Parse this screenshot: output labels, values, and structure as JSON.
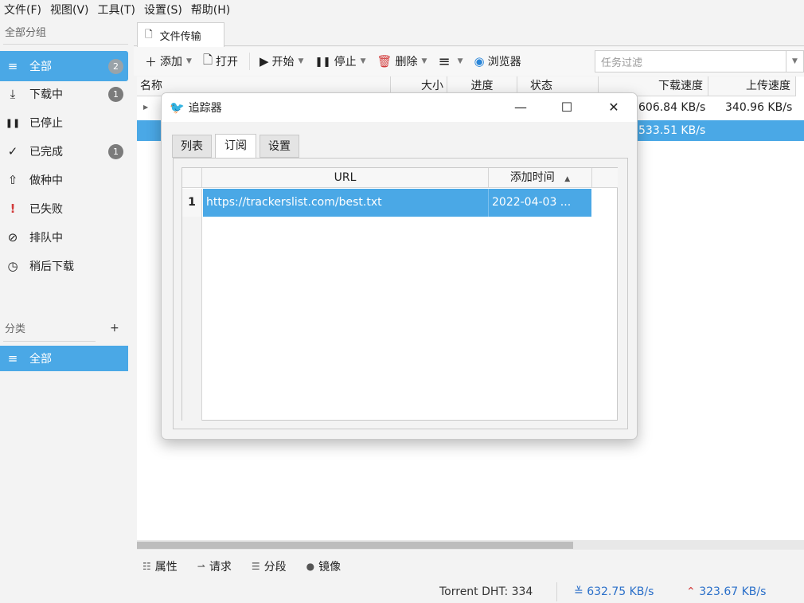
{
  "menu": [
    "文件(F)",
    "视图(V)",
    "工具(T)",
    "设置(S)",
    "帮助(H)"
  ],
  "sidebar": {
    "group_title": "全部分组",
    "items": [
      {
        "label": "全部",
        "icon": "≡",
        "badge": "2"
      },
      {
        "label": "下载中",
        "icon": "⤓",
        "badge": "1"
      },
      {
        "label": "已停止",
        "icon": "❚❚",
        "badge": ""
      },
      {
        "label": "已完成",
        "icon": "✓",
        "badge": "1"
      },
      {
        "label": "做种中",
        "icon": "⇧",
        "badge": ""
      },
      {
        "label": "已失败",
        "icon": "!",
        "badge": ""
      },
      {
        "label": "排队中",
        "icon": "⊘",
        "badge": ""
      },
      {
        "label": "稍后下载",
        "icon": "◷",
        "badge": ""
      }
    ],
    "category_title": "分类",
    "category_add": "+",
    "category_items": [
      {
        "label": "全部",
        "icon": "≡"
      }
    ]
  },
  "main_tab": {
    "label": "文件传输",
    "icon": "🗋"
  },
  "toolbar": {
    "add": "添加",
    "open": "打开",
    "start": "开始",
    "stop": "停止",
    "delete": "删除",
    "menu_icon": "≡",
    "browser": "浏览器",
    "filter_placeholder": "任务过滤"
  },
  "table": {
    "headers": [
      "名称",
      "大小",
      "进度",
      "状态",
      "下载速度",
      "上传速度"
    ],
    "rows": [
      {
        "name": "",
        "size": "",
        "progress": "",
        "status": "",
        "down": "606.84 KB/s",
        "up": "340.96 KB/s"
      },
      {
        "name": "",
        "size": "",
        "progress": "",
        "status": "",
        "down": "533.51 KB/s",
        "up": ""
      }
    ]
  },
  "bottom_tabs": [
    {
      "label": "属性",
      "icon": "☷"
    },
    {
      "label": "请求",
      "icon": "⇀"
    },
    {
      "label": "分段",
      "icon": "☰"
    },
    {
      "label": "镜像",
      "icon": "●"
    }
  ],
  "status": {
    "dht": "Torrent DHT:  334",
    "down": "632.75 KB/s",
    "up": "323.67 KB/s"
  },
  "dialog": {
    "title": "追踪器",
    "tabs": [
      "列表",
      "订阅",
      "设置"
    ],
    "active_tab": "订阅",
    "columns": [
      "URL",
      "添加时间"
    ],
    "rows": [
      {
        "num": "1",
        "url": "https://trackerslist.com/best.txt",
        "time": "2022-04-03 ..."
      }
    ]
  }
}
